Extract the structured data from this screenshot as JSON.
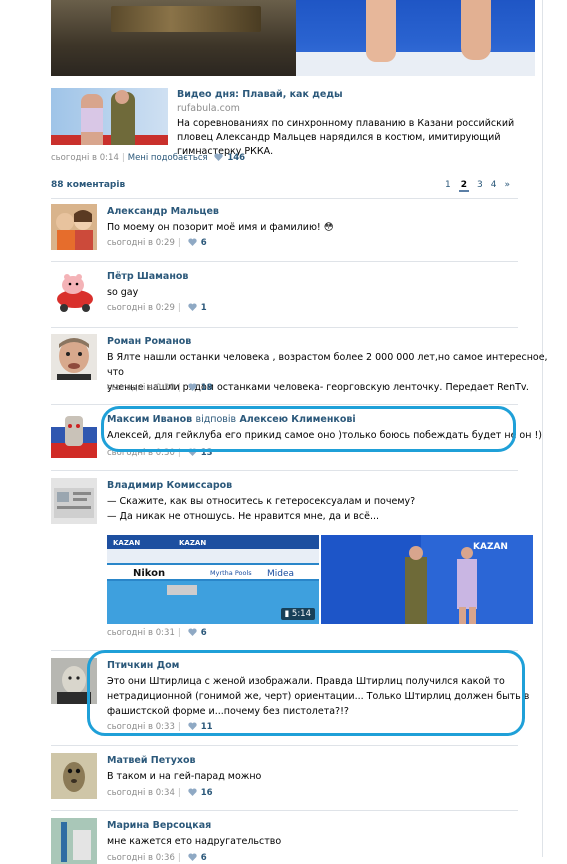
{
  "post": {
    "video_title": "Видео дня: Плавай, как деды",
    "video_source": "rufabula.com",
    "video_description": "На соревнованиях по синхронному плаванию в Казани российский пловец Александр Мальцев нарядился в костюм, имитирующий гимнастерку РККА.",
    "time": "сьогодні в 0:14",
    "like_label": "Мені подобається",
    "likes": "146"
  },
  "comments_header": {
    "count_label": "88 коментарів",
    "pages": [
      "1",
      "2",
      "3",
      "4",
      "»"
    ],
    "current_page": "2"
  },
  "comments": [
    {
      "author": "Александр Мальцев",
      "text": "По моему он позорит моё имя и фамилию! 😳",
      "time": "сьогодні в 0:29",
      "likes": "6"
    },
    {
      "author": "Пётр Шаманов",
      "text": "so gay",
      "time": "сьогодні в 0:29",
      "likes": "1"
    },
    {
      "author": "Роман Романов",
      "text_lines": [
        "В Ялте нашли останки человека , возрастом более 2 000 000 лет,но самое интересное, что",
        "ученые нашли рядом останками человека- георговскую ленточку. Передает RenTv."
      ],
      "time": "сьогодні в 0:30",
      "likes": "18"
    },
    {
      "author": "Максим Иванов",
      "reply_word": "відповів",
      "reply_to": "Алексею Клименкові",
      "text": "Алексей, для гейклуба его прикид самое оно )только боюсь побеждать будет не он !)",
      "time": "сьогодні в 0:30",
      "likes": "13"
    },
    {
      "author": "Владимир Комиссаров",
      "text_lines": [
        "— Скажите, как вы относитесь к гетеросексуалам и почему?",
        "— Да никак не отношусь. Не нравится мне, да и всё..."
      ],
      "time": "сьогодні в 0:31",
      "likes": "6",
      "attachment_duration": "5:14",
      "attachment_labels": [
        "KAZAN",
        "Nikon",
        "Myrtha Pools",
        "Midea"
      ]
    },
    {
      "author": "Птичкин Дом",
      "text_lines": [
        "Это они Штирлица с женой изображали. Правда Штирлиц получился какой то",
        "нетрадиционной (гонимой же, черт) ориентации... Только Штирлиц должен быть в",
        "фашистской форме и...почему без пистолета?!?"
      ],
      "time": "сьогодні в 0:33",
      "likes": "11"
    },
    {
      "author": "Матвей Петухов",
      "text": "В таком и на гей-парад можно",
      "time": "сьогодні в 0:34",
      "likes": "16"
    },
    {
      "author": "Марина Версоцкая",
      "text": "мне кажется ето надругательство",
      "time": "сьогодні в 0:36",
      "likes": "6"
    }
  ],
  "colors": {
    "link": "#2b587a",
    "meta": "#8c8c8c",
    "highlight_circle": "#1fa0d8",
    "divider": "#dfe3e8"
  }
}
